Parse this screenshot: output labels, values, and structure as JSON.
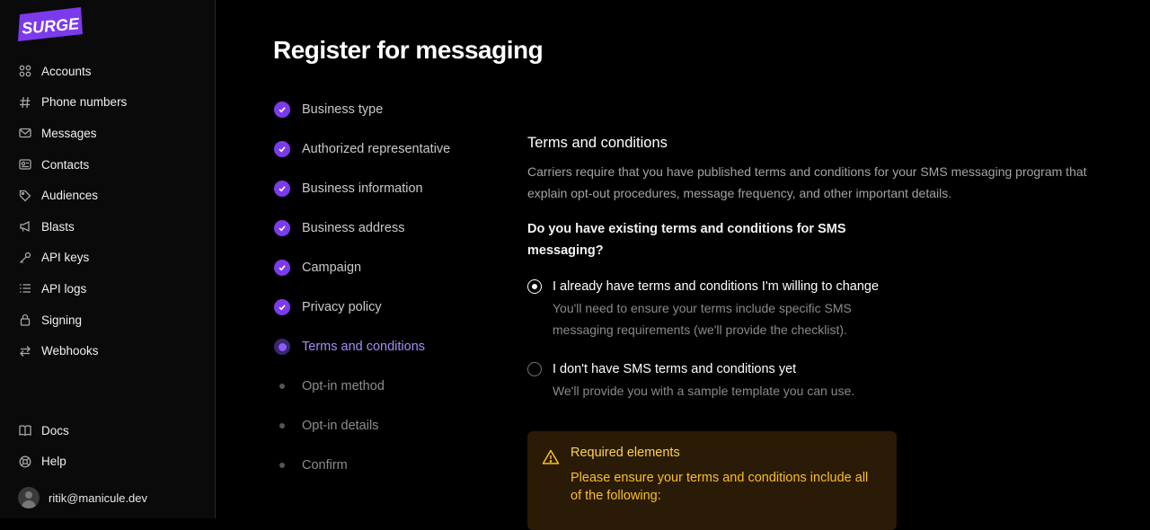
{
  "brand": {
    "logo_text": "SURGE",
    "accent": "#7c3aed"
  },
  "sidebar": {
    "items": [
      {
        "label": "Accounts",
        "icon": "accounts-icon"
      },
      {
        "label": "Phone numbers",
        "icon": "hash-icon"
      },
      {
        "label": "Messages",
        "icon": "envelope-icon"
      },
      {
        "label": "Contacts",
        "icon": "contact-card-icon"
      },
      {
        "label": "Audiences",
        "icon": "tag-icon"
      },
      {
        "label": "Blasts",
        "icon": "megaphone-icon"
      },
      {
        "label": "API keys",
        "icon": "key-icon"
      },
      {
        "label": "API logs",
        "icon": "list-icon"
      },
      {
        "label": "Signing",
        "icon": "lock-icon"
      },
      {
        "label": "Webhooks",
        "icon": "arrows-exchange-icon"
      }
    ],
    "bottom_items": [
      {
        "label": "Docs",
        "icon": "book-icon"
      },
      {
        "label": "Help",
        "icon": "help-circle-icon"
      }
    ],
    "user": {
      "email": "ritik@manicule.dev"
    }
  },
  "page": {
    "title": "Register for messaging"
  },
  "steps": [
    {
      "label": "Business type",
      "state": "done"
    },
    {
      "label": "Authorized representative",
      "state": "done"
    },
    {
      "label": "Business information",
      "state": "done"
    },
    {
      "label": "Business address",
      "state": "done"
    },
    {
      "label": "Campaign",
      "state": "done"
    },
    {
      "label": "Privacy policy",
      "state": "done"
    },
    {
      "label": "Terms and conditions",
      "state": "active"
    },
    {
      "label": "Opt-in method",
      "state": "pending"
    },
    {
      "label": "Opt-in details",
      "state": "pending"
    },
    {
      "label": "Confirm",
      "state": "pending"
    }
  ],
  "form": {
    "section_title": "Terms and conditions",
    "description": "Carriers require that you have published terms and conditions for your SMS messaging program that explain opt-out procedures, message frequency, and other important details.",
    "question": "Do you have existing terms and conditions for SMS messaging?",
    "options": [
      {
        "title": "I already have terms and conditions I'm willing to change",
        "desc": "You'll need to ensure your terms include specific SMS messaging requirements (we'll provide the checklist).",
        "selected": true
      },
      {
        "title": "I don't have SMS terms and conditions yet",
        "desc": "We'll provide you with a sample template you can use.",
        "selected": false
      }
    ]
  },
  "alert": {
    "title": "Required elements",
    "body": "Please ensure your terms and conditions include all of the following:",
    "icon": "warning-triangle-icon"
  }
}
